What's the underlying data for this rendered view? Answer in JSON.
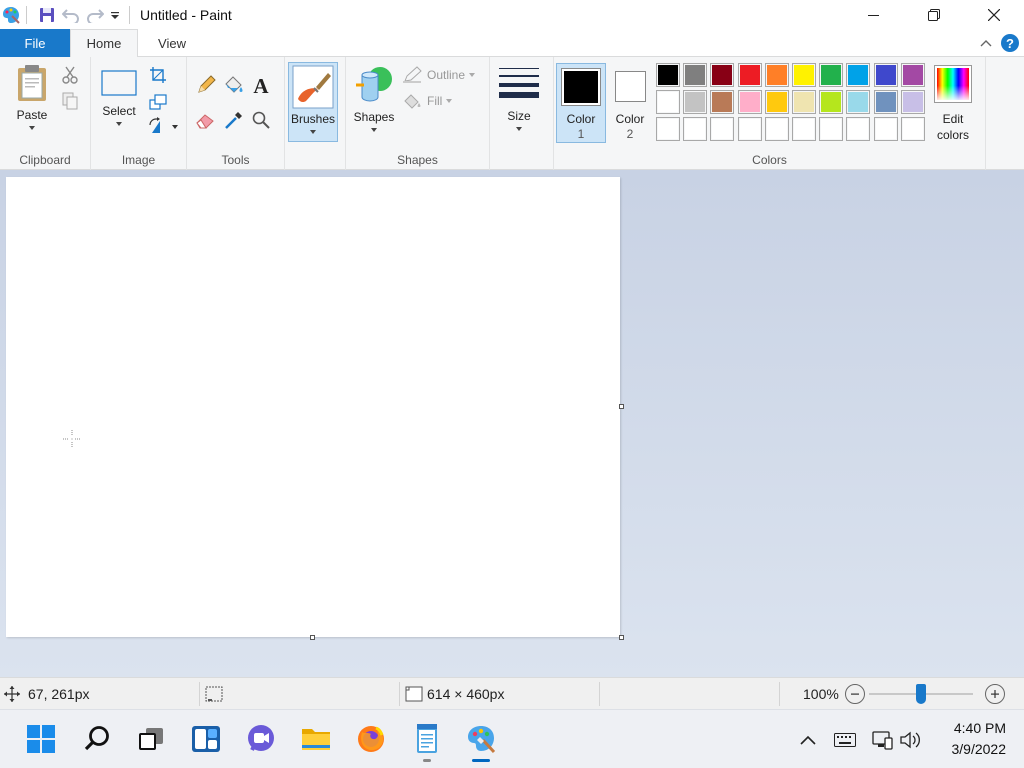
{
  "window": {
    "title": "Untitled - Paint"
  },
  "quick_access": {
    "icons": [
      "paint-app-icon",
      "save-icon",
      "undo-icon",
      "redo-icon",
      "customize-dropdown-icon"
    ]
  },
  "tabs": {
    "file": "File",
    "home": "Home",
    "view": "View"
  },
  "ribbon": {
    "clipboard": {
      "label": "Clipboard",
      "paste": "Paste"
    },
    "image": {
      "label": "Image",
      "select": "Select"
    },
    "tools": {
      "label": "Tools"
    },
    "brushes": {
      "label": "Brushes"
    },
    "shapes": {
      "label": "Shapes",
      "shapes_btn": "Shapes",
      "outline": "Outline",
      "fill": "Fill"
    },
    "size": {
      "label": "Size"
    },
    "color1": {
      "line1": "Color",
      "line2": "1",
      "value": "#000000"
    },
    "color2": {
      "line1": "Color",
      "line2": "2",
      "value": "#ffffff"
    },
    "colors": {
      "label": "Colors"
    },
    "edit_colors": {
      "line1": "Edit",
      "line2": "colors"
    }
  },
  "palette": {
    "row1": [
      "#000000",
      "#7f7f7f",
      "#880015",
      "#ed1c24",
      "#ff7f27",
      "#fff200",
      "#22b14c",
      "#00a2e8",
      "#3f48cc",
      "#a349a4"
    ],
    "row2": [
      "#ffffff",
      "#c3c3c3",
      "#b97a57",
      "#ffaec9",
      "#ffc90e",
      "#efe4b0",
      "#b5e61d",
      "#99d9ea",
      "#7092be",
      "#c8bfe7"
    ],
    "row3": [
      "#ffffff",
      "#ffffff",
      "#ffffff",
      "#ffffff",
      "#ffffff",
      "#ffffff",
      "#ffffff",
      "#ffffff",
      "#ffffff",
      "#ffffff"
    ]
  },
  "status": {
    "cursor_pos": "67, 261px",
    "canvas_size": "614 × 460px",
    "zoom": "100%",
    "zoom_level": 0.5
  },
  "taskbar": {
    "apps": [
      "windows-start-icon",
      "search-icon",
      "task-view-icon",
      "widgets-icon",
      "chat-icon",
      "file-explorer-icon",
      "firefox-icon",
      "notepad-icon",
      "paint-icon"
    ],
    "time": "4:40 PM",
    "date": "3/9/2022"
  },
  "colors": {
    "file_tab": "#1979ca",
    "accent": "#0067c0",
    "selected_btn": "#cce4f7"
  }
}
